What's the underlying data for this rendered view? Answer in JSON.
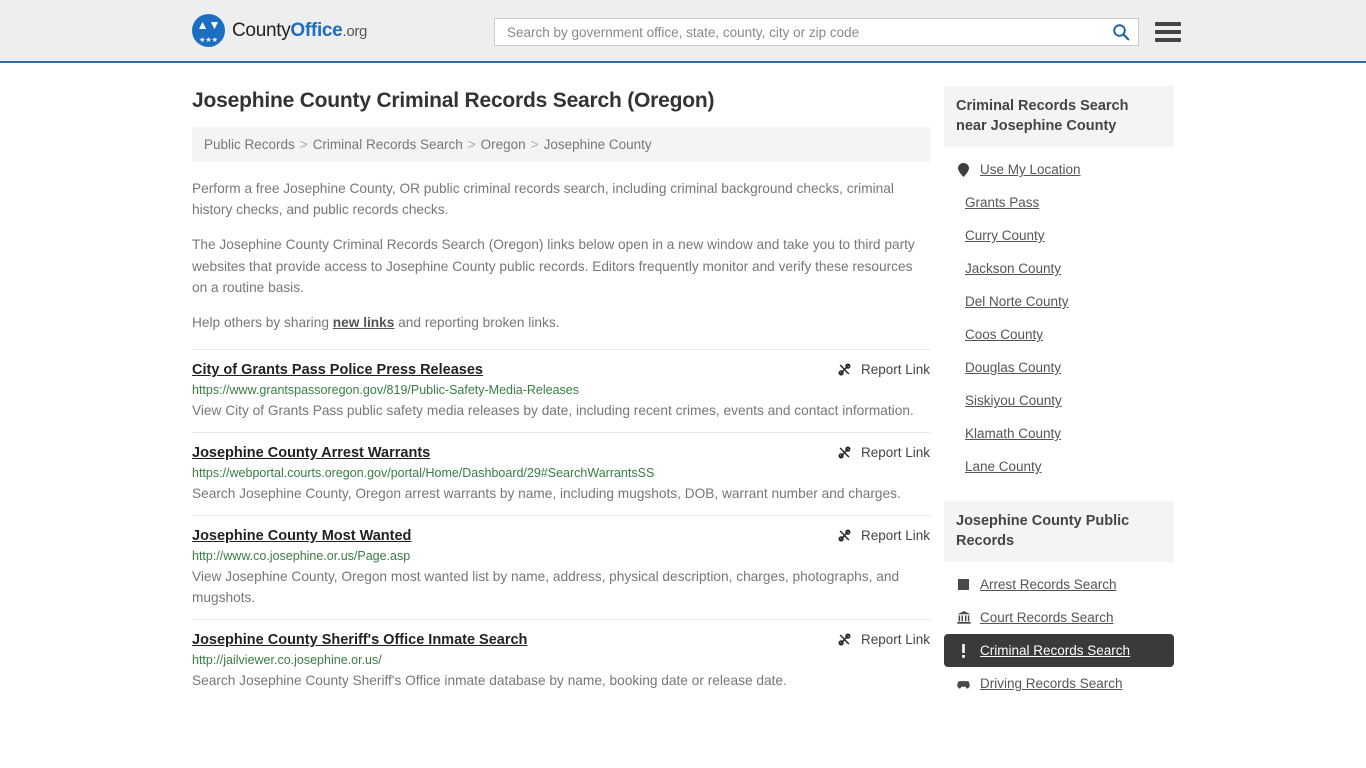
{
  "header": {
    "logo": {
      "part1": "County",
      "part2": "Office",
      "part3": ".org",
      "eagle_icon": "eagle-icon",
      "stars_icon": "three-stars-icon"
    },
    "search": {
      "placeholder": "Search by government office, state, county, city or zip code",
      "value": "",
      "search_icon": "search-icon"
    },
    "menu_icon": "hamburger-menu-icon"
  },
  "main": {
    "title": "Josephine County Criminal Records Search (Oregon)",
    "breadcrumb": [
      "Public Records",
      "Criminal Records Search",
      "Oregon",
      "Josephine County"
    ],
    "breadcrumb_separator": ">",
    "intro": {
      "p1": "Perform a free Josephine County, OR public criminal records search, including criminal background checks, criminal history checks, and public records checks.",
      "p2": "The Josephine County Criminal Records Search (Oregon) links below open in a new window and take you to third party websites that provide access to Josephine County public records. Editors frequently monitor and verify these resources on a routine basis.",
      "p3_before": "Help others by sharing ",
      "p3_link": "new links",
      "p3_after": " and reporting broken links."
    },
    "report_link_label": "Report Link",
    "report_link_icon": "broken-link-icon",
    "results": [
      {
        "title": "City of Grants Pass Police Press Releases",
        "url": "https://www.grantspassoregon.gov/819/Public-Safety-Media-Releases",
        "description": "View City of Grants Pass public safety media releases by date, including recent crimes, events and contact information."
      },
      {
        "title": "Josephine County Arrest Warrants",
        "url": "https://webportal.courts.oregon.gov/portal/Home/Dashboard/29#SearchWarrantsSS",
        "description": "Search Josephine County, Oregon arrest warrants by name, including mugshots, DOB, warrant number and charges."
      },
      {
        "title": "Josephine County Most Wanted",
        "url": "http://www.co.josephine.or.us/Page.asp",
        "description": "View Josephine County, Oregon most wanted list by name, address, physical description, charges, photographs, and mugshots."
      },
      {
        "title": "Josephine County Sheriff's Office Inmate Search",
        "url": "http://jailviewer.co.josephine.or.us/",
        "description": "Search Josephine County Sheriff's Office inmate database by name, booking date or release date."
      }
    ]
  },
  "sidebar": {
    "nearby": {
      "heading": "Criminal Records Search near Josephine County",
      "items": [
        {
          "label": "Use My Location",
          "icon": "map-pin-icon"
        },
        {
          "label": "Grants Pass",
          "icon": ""
        },
        {
          "label": "Curry County",
          "icon": ""
        },
        {
          "label": "Jackson County",
          "icon": ""
        },
        {
          "label": "Del Norte County",
          "icon": ""
        },
        {
          "label": "Coos County",
          "icon": ""
        },
        {
          "label": "Douglas County",
          "icon": ""
        },
        {
          "label": "Siskiyou County",
          "icon": ""
        },
        {
          "label": "Klamath County",
          "icon": ""
        },
        {
          "label": "Lane County",
          "icon": ""
        }
      ]
    },
    "public_records": {
      "heading": "Josephine County Public Records",
      "items": [
        {
          "label": "Arrest Records Search",
          "icon": "square-icon",
          "active": false
        },
        {
          "label": "Court Records Search",
          "icon": "courthouse-icon",
          "active": false
        },
        {
          "label": "Criminal Records Search",
          "icon": "exclamation-icon",
          "active": true
        },
        {
          "label": "Driving Records Search",
          "icon": "car-icon",
          "active": false
        }
      ]
    }
  },
  "colors": {
    "accent_blue": "#1b6ec2",
    "header_bg": "#eeeeee",
    "url_green": "#3a7d44",
    "active_bg": "#3a3a3a"
  }
}
